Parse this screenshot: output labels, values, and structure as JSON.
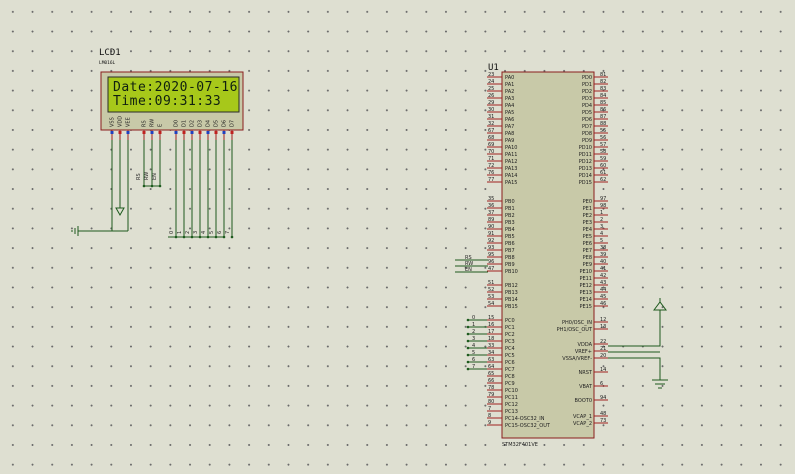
{
  "lcd": {
    "ref": "LCD1",
    "model": "LM016L",
    "line1": "Date:2020-07-16",
    "line2": "Time:09:31:33",
    "pins": [
      "VSS",
      "VDD",
      "VEE",
      "RS",
      "RW",
      "E",
      "D0",
      "D1",
      "D2",
      "D3",
      "D4",
      "D5",
      "D6",
      "D7"
    ],
    "ctrl_nets": [
      "RS",
      "RW",
      "EN"
    ],
    "data_nets": [
      "0",
      "1",
      "2",
      "3",
      "4",
      "5",
      "6",
      "7"
    ]
  },
  "mcu": {
    "ref": "U1",
    "part": "STM32F401VE",
    "left_pins": [
      {
        "num": "23",
        "name": "PA0"
      },
      {
        "num": "24",
        "name": "PA1"
      },
      {
        "num": "25",
        "name": "PA2"
      },
      {
        "num": "26",
        "name": "PA3"
      },
      {
        "num": "29",
        "name": "PA4"
      },
      {
        "num": "30",
        "name": "PA5"
      },
      {
        "num": "31",
        "name": "PA6"
      },
      {
        "num": "32",
        "name": "PA7"
      },
      {
        "num": "67",
        "name": "PA8"
      },
      {
        "num": "68",
        "name": "PA9"
      },
      {
        "num": "69",
        "name": "PA10"
      },
      {
        "num": "70",
        "name": "PA11"
      },
      {
        "num": "71",
        "name": "PA12"
      },
      {
        "num": "72",
        "name": "PA13"
      },
      {
        "num": "76",
        "name": "PA14"
      },
      {
        "num": "77",
        "name": "PA15"
      },
      {
        "num": "35",
        "name": "PB0"
      },
      {
        "num": "36",
        "name": "PB1"
      },
      {
        "num": "37",
        "name": "PB2"
      },
      {
        "num": "89",
        "name": "PB3"
      },
      {
        "num": "90",
        "name": "PB4"
      },
      {
        "num": "91",
        "name": "PB5"
      },
      {
        "num": "92",
        "name": "PB6"
      },
      {
        "num": "93",
        "name": "PB7"
      },
      {
        "num": "95",
        "name": "PB8"
      },
      {
        "num": "96",
        "name": "PB9"
      },
      {
        "num": "47",
        "name": "PB10"
      },
      {
        "num": "51",
        "name": "PB12"
      },
      {
        "num": "52",
        "name": "PB13"
      },
      {
        "num": "53",
        "name": "PB14"
      },
      {
        "num": "54",
        "name": "PB15"
      },
      {
        "num": "15",
        "name": "PC0"
      },
      {
        "num": "16",
        "name": "PC1"
      },
      {
        "num": "17",
        "name": "PC2"
      },
      {
        "num": "18",
        "name": "PC3"
      },
      {
        "num": "33",
        "name": "PC4"
      },
      {
        "num": "34",
        "name": "PC5"
      },
      {
        "num": "63",
        "name": "PC6"
      },
      {
        "num": "64",
        "name": "PC7"
      },
      {
        "num": "65",
        "name": "PC8"
      },
      {
        "num": "66",
        "name": "PC9"
      },
      {
        "num": "78",
        "name": "PC10"
      },
      {
        "num": "79",
        "name": "PC11"
      },
      {
        "num": "80",
        "name": "PC12"
      },
      {
        "num": "7",
        "name": "PC13"
      },
      {
        "num": "8",
        "name": "PC14-OSC32_IN"
      },
      {
        "num": "9",
        "name": "PC15-OSC32_OUT"
      }
    ],
    "right_pins": [
      {
        "num": "81",
        "name": "PD0"
      },
      {
        "num": "82",
        "name": "PD1"
      },
      {
        "num": "83",
        "name": "PD2"
      },
      {
        "num": "84",
        "name": "PD3"
      },
      {
        "num": "85",
        "name": "PD4"
      },
      {
        "num": "86",
        "name": "PD5"
      },
      {
        "num": "87",
        "name": "PD6"
      },
      {
        "num": "88",
        "name": "PD7"
      },
      {
        "num": "55",
        "name": "PD8"
      },
      {
        "num": "56",
        "name": "PD9"
      },
      {
        "num": "57",
        "name": "PD10"
      },
      {
        "num": "58",
        "name": "PD11"
      },
      {
        "num": "59",
        "name": "PD12"
      },
      {
        "num": "60",
        "name": "PD13"
      },
      {
        "num": "61",
        "name": "PD14"
      },
      {
        "num": "62",
        "name": "PD15"
      },
      {
        "num": "97",
        "name": "PE0"
      },
      {
        "num": "98",
        "name": "PE1"
      },
      {
        "num": "1",
        "name": "PE2"
      },
      {
        "num": "2",
        "name": "PE3"
      },
      {
        "num": "3",
        "name": "PE4"
      },
      {
        "num": "4",
        "name": "PE5"
      },
      {
        "num": "5",
        "name": "PE6"
      },
      {
        "num": "38",
        "name": "PE7"
      },
      {
        "num": "39",
        "name": "PE8"
      },
      {
        "num": "40",
        "name": "PE9"
      },
      {
        "num": "41",
        "name": "PE10"
      },
      {
        "num": "42",
        "name": "PE11"
      },
      {
        "num": "43",
        "name": "PE12"
      },
      {
        "num": "44",
        "name": "PE13"
      },
      {
        "num": "45",
        "name": "PE14"
      },
      {
        "num": "46",
        "name": "PE15"
      },
      {
        "num": "12",
        "name": "PH0/OSC_IN"
      },
      {
        "num": "13",
        "name": "PH1/OSC_OUT"
      },
      {
        "num": "22",
        "name": "VDDA"
      },
      {
        "num": "21",
        "name": "VREF+"
      },
      {
        "num": "20",
        "name": "VSSA/VREF-"
      },
      {
        "num": "14",
        "name": "NRST"
      },
      {
        "num": "6",
        "name": "VBAT"
      },
      {
        "num": "94",
        "name": "BOOT0"
      },
      {
        "num": "48",
        "name": "VCAP_1"
      },
      {
        "num": "73",
        "name": "VCAP_2"
      }
    ],
    "ctrl_labels": [
      "RS",
      "RW",
      "EN"
    ],
    "pc_labels": [
      "0",
      "1",
      "2",
      "3",
      "4",
      "5",
      "6",
      "7"
    ]
  },
  "colors": {
    "background": "#dedfd1",
    "body_fill": "#c8c9a8",
    "body_stroke": "#8a1d1d",
    "wire": "#1d5a1d",
    "lcd_screen": "#a7c81a"
  }
}
